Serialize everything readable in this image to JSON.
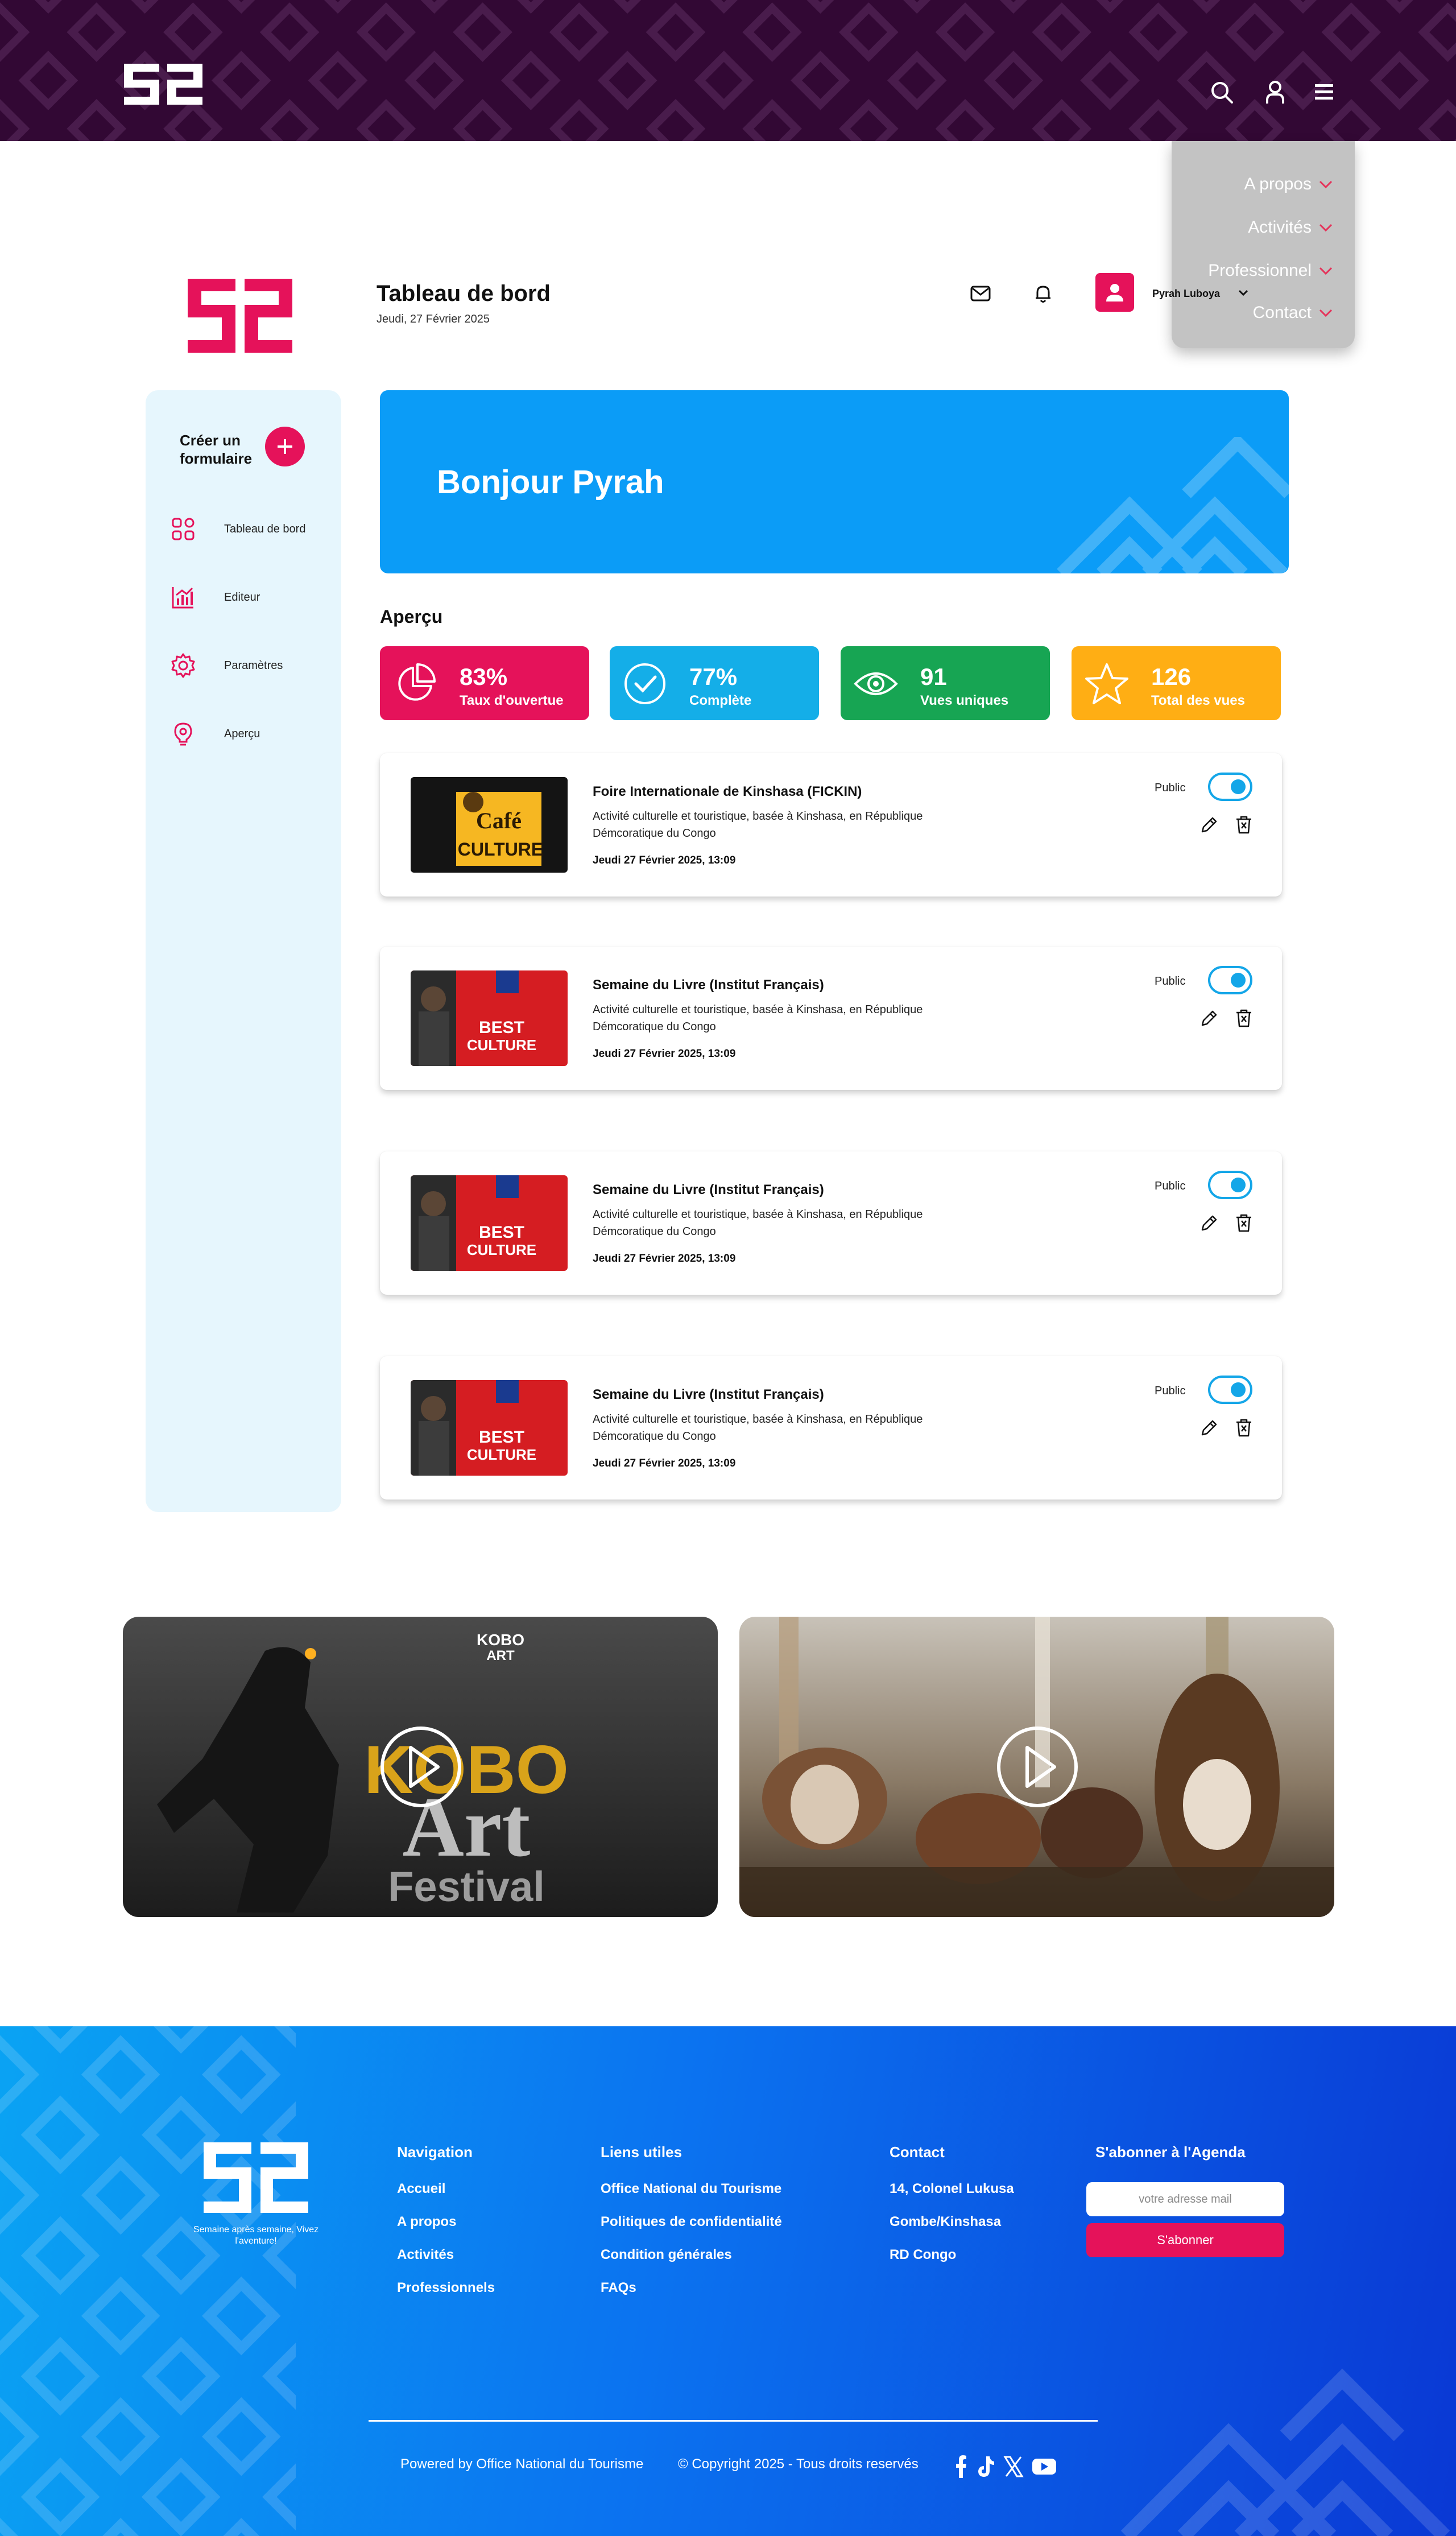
{
  "header": {
    "menu": [
      {
        "label": "A propos"
      },
      {
        "label": "Activités"
      },
      {
        "label": "Professionnel"
      },
      {
        "label": "Contact"
      }
    ]
  },
  "dashboard": {
    "title": "Tableau de bord",
    "date": "Jeudi, 27 Février 2025",
    "user_name": "Pyrah Luboya"
  },
  "sidebar": {
    "create_label": "Créer un formulaire",
    "items": [
      {
        "label": "Tableau de bord",
        "icon": "grid-icon"
      },
      {
        "label": "Editeur",
        "icon": "chart-icon"
      },
      {
        "label": "Paramètres",
        "icon": "gear-icon"
      },
      {
        "label": "Aperçu",
        "icon": "lightbulb-icon"
      }
    ]
  },
  "hero": {
    "greeting": "Bonjour Pyrah"
  },
  "overview": {
    "title": "Aperçu",
    "stats": [
      {
        "value": "83%",
        "label": "Taux d'ouvertue",
        "color": "#e5125a",
        "icon": "pie-chart-icon"
      },
      {
        "value": "77%",
        "label": "Complète",
        "color": "#14aee8",
        "icon": "check-circle-icon"
      },
      {
        "value": "91",
        "label": "Vues uniques",
        "color": "#17a553",
        "icon": "eye-icon"
      },
      {
        "value": "126",
        "label": "Total des vues",
        "color": "#ffae14",
        "icon": "star-icon"
      }
    ]
  },
  "events": [
    {
      "title": "Foire Internationale de Kinshasa (FICKIN)",
      "description": "Activité culturelle et touristique, basée à Kinshasa, en République Démcoratique du Congo",
      "date": "Jeudi 27 Février 2025, 13:09",
      "visibility": "Public",
      "image_text": [
        "Café",
        "CULTURE"
      ]
    },
    {
      "title": "Semaine du Livre (Institut Français)",
      "description": "Activité culturelle et touristique, basée à Kinshasa, en République Démcoratique du Congo",
      "date": "Jeudi 27 Février 2025, 13:09",
      "visibility": "Public",
      "image_text": [
        "BEST",
        "CULTURE"
      ]
    },
    {
      "title": "Semaine du Livre (Institut Français)",
      "description": "Activité culturelle et touristique, basée à Kinshasa, en République Démcoratique du Congo",
      "date": "Jeudi 27 Février 2025, 13:09",
      "visibility": "Public",
      "image_text": [
        "BEST",
        "CULTURE"
      ]
    },
    {
      "title": "Semaine du Livre (Institut Français)",
      "description": "Activité culturelle et touristique, basée à Kinshasa, en République Démcoratique du Congo",
      "date": "Jeudi 27 Février 2025, 13:09",
      "visibility": "Public",
      "image_text": [
        "BEST",
        "CULTURE"
      ]
    }
  ],
  "videos": [
    {
      "poster_text": [
        "KOBO",
        "ART",
        "Art",
        "Festival"
      ]
    },
    {
      "poster_text": []
    }
  ],
  "footer": {
    "tagline": "Semaine après semaine, Vivez l'aventure!",
    "navigation": {
      "title": "Navigation",
      "links": [
        "Accueil",
        "A propos",
        "Activités",
        "Professionnels"
      ]
    },
    "useful": {
      "title": "Liens utiles",
      "links": [
        "Office National du Tourisme",
        "Politiques de confidentialité",
        "Condition générales",
        "FAQs"
      ]
    },
    "contact": {
      "title": "Contact",
      "lines": [
        "14, Colonel Lukusa",
        "Gombe/Kinshasa",
        "RD Congo"
      ]
    },
    "subscribe": {
      "title": "S'abonner à l'Agenda",
      "placeholder": "votre adresse mail",
      "button": "S'abonner"
    },
    "powered": "Powered by Office National du Tourisme",
    "copyright": "© Copyright 2025 - Tous droits reservés"
  },
  "colors": {
    "brand_pink": "#e5125a",
    "brand_purple": "#320834",
    "hero_blue": "#0b9cf7"
  }
}
